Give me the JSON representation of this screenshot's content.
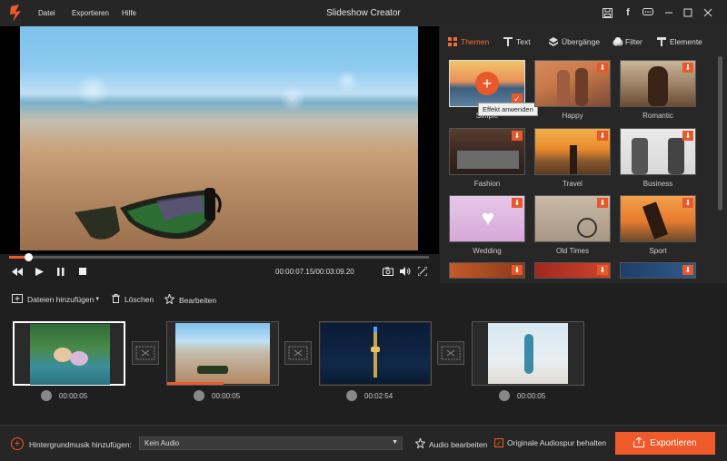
{
  "menu": {
    "file": "Datei",
    "export": "Exportieren",
    "help": "Hilfe"
  },
  "window": {
    "title": "Slideshow Creator"
  },
  "player": {
    "timecode": "00:00:07.15/00:03:09.20",
    "progress": 0.045
  },
  "tabs": [
    {
      "label": "Themen",
      "icon": "themes-icon"
    },
    {
      "label": "Text",
      "icon": "text-icon"
    },
    {
      "label": "Übergänge",
      "icon": "transitions-icon"
    },
    {
      "label": "Filter",
      "icon": "filter-icon"
    },
    {
      "label": "Elemente",
      "icon": "elements-icon"
    }
  ],
  "themes": [
    {
      "label": "Simple"
    },
    {
      "label": "Happy"
    },
    {
      "label": "Romantic"
    },
    {
      "label": "Fashion"
    },
    {
      "label": "Travel"
    },
    {
      "label": "Business"
    },
    {
      "label": "Wedding"
    },
    {
      "label": "Old Times"
    },
    {
      "label": "Sport"
    }
  ],
  "tooltip": "Effekt anwenden",
  "media_toolbar": {
    "add": "Dateien hinzufügen",
    "delete": "Löschen",
    "edit": "Bearbeiten"
  },
  "clips": [
    {
      "duration": "00:00:05"
    },
    {
      "duration": "00:00:05"
    },
    {
      "duration": "00:02:54"
    },
    {
      "duration": "00:00:05"
    }
  ],
  "bottom": {
    "music_label": "Hintergrundmusik hinzufügen:",
    "audio_value": "Kein Audio",
    "edit_audio": "Audio bearbeiten",
    "keep_audio": "Originale Audiospur behalten",
    "export": "Exportieren"
  },
  "colors": {
    "accent": "#ef5a2a",
    "background": "#1f1f1f"
  }
}
